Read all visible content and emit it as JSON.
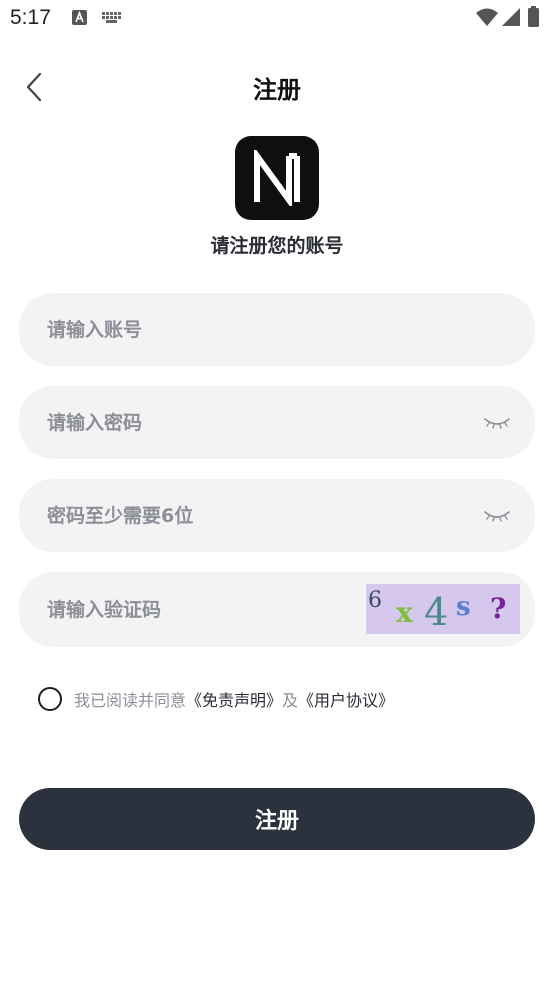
{
  "status_bar": {
    "time": "5:17",
    "icons": [
      "text-input-icon",
      "keyboard-icon",
      "wifi-icon",
      "signal-icon",
      "battery-icon"
    ]
  },
  "header": {
    "title": "注册",
    "back_icon": "chevron-left-icon"
  },
  "brand": {
    "logo_letter": "N",
    "subtitle": "请注册您的账号"
  },
  "form": {
    "account_placeholder": "请输入账号",
    "password_placeholder": "请输入密码",
    "confirm_placeholder": "密码至少需要6位",
    "captcha_placeholder": "请输入验证码",
    "password_toggle_icon": "eye-closed-icon",
    "captcha_chars": [
      "6",
      "x",
      "4",
      "s",
      "?"
    ]
  },
  "agreement": {
    "prefix": "我已阅读并同意",
    "disclaimer_link": "《免责声明》",
    "joiner": "及",
    "user_agreement_link": "《用户协议》",
    "checked": false
  },
  "actions": {
    "register_label": "注册"
  },
  "colors": {
    "background": "#ffffff",
    "field_bg": "#f3f3f4",
    "button_bg": "#2c313e",
    "placeholder": "#8c8f98",
    "captcha_bg": "#d6c7ec"
  }
}
